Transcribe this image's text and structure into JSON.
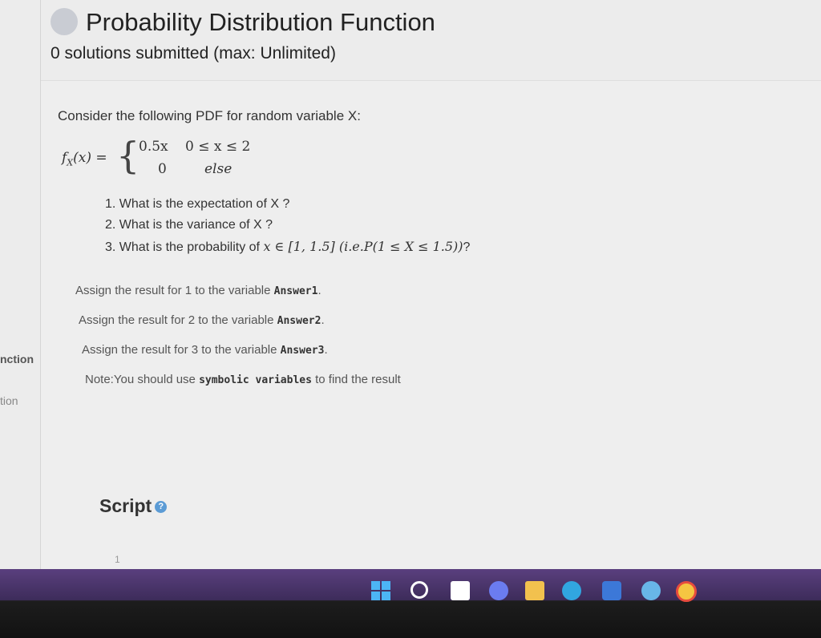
{
  "left_rail": {
    "item1": "nction",
    "item2": "tion"
  },
  "header": {
    "title": "Probability Distribution Function",
    "subtitle": "0 solutions submitted (max: Unlimited)"
  },
  "problem": {
    "intro": "Consider the following PDF for random variable X:",
    "formula": {
      "lhs": "f",
      "lhs_sub": "X",
      "lhs_arg": "(x) =",
      "case1_value": "0.5x",
      "case1_cond": "0 ≤ x ≤ 2",
      "case2_value": "0",
      "case2_cond": "else"
    },
    "questions": [
      "1. What is the expectation of X ?",
      "2. What is the variance of X ?",
      "3. What is the probability of "
    ],
    "q3_math": "x ∈ [1, 1.5] (i.e.P(1 ≤ X ≤ 1.5))",
    "q3_end": "?",
    "assign": [
      {
        "text": "Assign the result for 1 to the variable ",
        "var": "Answer1",
        "end": "."
      },
      {
        "text": "Assign the result for 2 to the variable ",
        "var": "Answer2",
        "end": "."
      },
      {
        "text": "Assign the result for 3 to the variable ",
        "var": "Answer3",
        "end": "."
      }
    ],
    "note_prefix": "Note:You should use ",
    "note_bold": "symbolic variables",
    "note_suffix": " to find the result"
  },
  "script": {
    "label": "Script",
    "help_icon": "?",
    "line_number": "1"
  },
  "taskbar": {
    "icons": [
      "windows-icon",
      "search-icon",
      "task-view-icon",
      "chat-icon",
      "file-explorer-icon",
      "edge-icon",
      "store-icon",
      "app-icon",
      "chrome-icon"
    ]
  }
}
